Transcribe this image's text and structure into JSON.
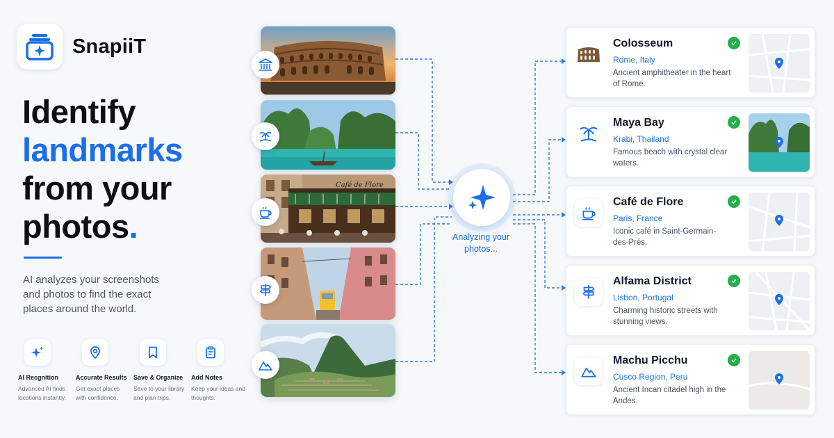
{
  "brand": {
    "name": "SnapiiT"
  },
  "hero": {
    "line1": "Identify",
    "line2": "landmarks",
    "line3": "from your",
    "line4": "photos",
    "period": ".",
    "subtitle": "AI analyzes your screenshots and photos to find the exact places around the world."
  },
  "features": [
    {
      "icon": "sparkle-icon",
      "title": "AI Recgnition",
      "desc": "Advanced AI finds locations instantly."
    },
    {
      "icon": "location-pin-icon",
      "title": "Accurate Results",
      "desc": "Get exact places with confidence."
    },
    {
      "icon": "bookmark-icon",
      "title": "Save & Organize",
      "desc": "Save to your library and plan trips."
    },
    {
      "icon": "notes-icon",
      "title": "Add Notes",
      "desc": "Keep your ideas and thoughts."
    }
  ],
  "photos": [
    {
      "icon": "museum-icon"
    },
    {
      "icon": "palm-island-icon",
      "caption": ""
    },
    {
      "icon": "coffee-cup-icon",
      "sign": "Café de Flore"
    },
    {
      "icon": "signpost-icon"
    },
    {
      "icon": "mountain-icon"
    }
  ],
  "ai": {
    "status": "Analyzing your photos..."
  },
  "results": [
    {
      "name": "Colosseum",
      "location": "Rome, Italy",
      "desc": "Ancient amphitheater in the heart of Rome.",
      "icon": "colosseum-icon",
      "map": "street-map"
    },
    {
      "name": "Maya Bay",
      "location": "Krabi, Thailand",
      "desc": "Famous beach with crystal clear waters.",
      "icon": "palm-tree-icon",
      "map": "photo-thumb"
    },
    {
      "name": "Café de Flore",
      "location": "Paris, France",
      "desc": "Iconic café in Saint-Germain-des-Prés.",
      "icon": "coffee-cup-icon",
      "map": "street-map"
    },
    {
      "name": "Alfama District",
      "location": "Lisbon, Portugal",
      "desc": "Charming historic streets with stunning views.",
      "icon": "signpost-icon",
      "map": "street-map"
    },
    {
      "name": "Machu Picchu",
      "location": "Cusco Region, Peru",
      "desc": "Ancient Incan citadel high in the Andes.",
      "icon": "mountain-icon",
      "map": "plain-map"
    }
  ],
  "colors": {
    "accent": "#1a6fe8",
    "success": "#22b04b",
    "text": "#111827",
    "muted": "#4b5563",
    "background": "#f6f8fb"
  }
}
